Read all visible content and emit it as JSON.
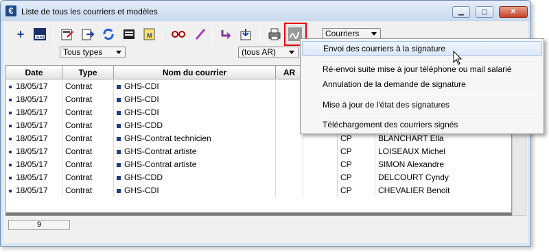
{
  "window": {
    "title": "Liste de tous les courriers et modèles"
  },
  "toolbar": {
    "courriers_dropdown": "Courriers"
  },
  "filters": {
    "types": "Tous types",
    "ar": "(tous AR)"
  },
  "table": {
    "headers": [
      "Date",
      "Type",
      "Nom du courrier",
      "AR"
    ],
    "rows": [
      {
        "date": "18/05/17",
        "type": "Contrat",
        "nom": "GHS-CDI",
        "ar": "",
        "salarie": ""
      },
      {
        "date": "18/05/17",
        "type": "Contrat",
        "nom": "GHS-CDI",
        "ar": "",
        "salarie": ""
      },
      {
        "date": "18/05/17",
        "type": "Contrat",
        "nom": "GHS-CDI",
        "ar": "",
        "salarie": ""
      },
      {
        "date": "18/05/17",
        "type": "Contrat",
        "nom": "GHS-CDD",
        "ar": "",
        "salarie": ""
      },
      {
        "date": "18/05/17",
        "type": "Contrat",
        "nom": "GHS-Contrat technicien",
        "ar": "CP",
        "salarie": "BLANCHART Ella"
      },
      {
        "date": "18/05/17",
        "type": "Contrat",
        "nom": "GHS-Contrat artiste",
        "ar": "CP",
        "salarie": "LOISEAUX Michel"
      },
      {
        "date": "18/05/17",
        "type": "Contrat",
        "nom": "GHS-Contrat artiste",
        "ar": "CP",
        "salarie": "SIMON Alexandre"
      },
      {
        "date": "18/05/17",
        "type": "Contrat",
        "nom": "GHS-CDD",
        "ar": "CP",
        "salarie": "DELCOURT Cyndy"
      },
      {
        "date": "18/05/17",
        "type": "Contrat",
        "nom": "GHS-CDI",
        "ar": "CP",
        "salarie": "CHEVALIER Benoit"
      }
    ]
  },
  "status": {
    "count": "9"
  },
  "menu": {
    "items": [
      "Envoi des courriers à la signature",
      "Ré-envoi suite mise à jour téléphone ou mail salarié",
      "Annulation de la demande de signature",
      "Mise à jour de l'état des signatures",
      "Téléchargement des courriers signés"
    ]
  }
}
